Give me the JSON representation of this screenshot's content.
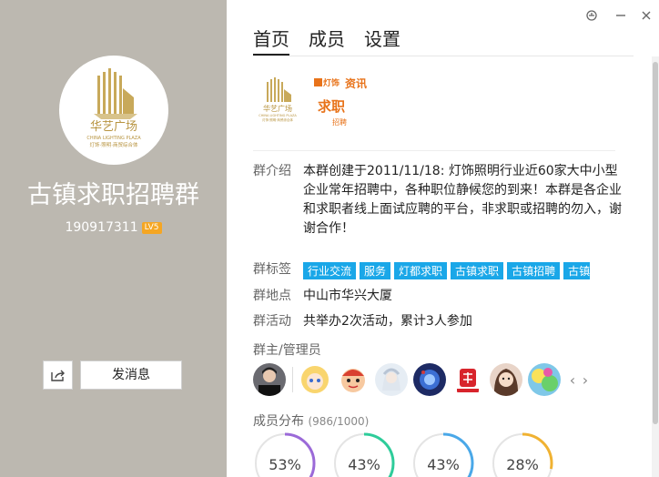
{
  "left": {
    "group_name": "古镇求职招聘群",
    "group_id": "190917311",
    "level": "LV5",
    "send_message_label": "发消息",
    "logo_cn": "华艺广场",
    "logo_en": "CHINA LIGHTING PLAZA",
    "logo_sub": "灯饰·照明·商贸综合体"
  },
  "tabs": [
    {
      "label": "首页",
      "active": true
    },
    {
      "label": "成员",
      "active": false
    },
    {
      "label": "设置",
      "active": false
    }
  ],
  "thumb": {
    "cn": "华艺广场",
    "en": "CHINA LIGHTING PLAZA",
    "sub": "灯饰·照明·商贸综合体",
    "lamp": "灯饰",
    "info": "资讯",
    "job": "求职",
    "hire": "招聘"
  },
  "info": {
    "intro_label": "群介绍",
    "intro_text": "本群创建于2011/11/18: 灯饰照明行业近60家大中小型企业常年招聘中，各种职位静候您的到来！本群是各企业和求职者线上面试应聘的平台，非求职或招聘的勿入，谢谢合作！",
    "tags_label": "群标签",
    "tags": [
      "行业交流",
      "服务",
      "灯都求职",
      "古镇求职",
      "古镇招聘",
      "古镇"
    ],
    "location_label": "群地点",
    "location": "中山市华兴大厦",
    "activity_label": "群活动",
    "activity": "共举办2次活动，累计3人参加",
    "admin_label": "群主/管理员",
    "dist_label": "成员分布",
    "dist_count": "(986/1000)"
  },
  "distribution": [
    {
      "percent": "53%",
      "value": 0.53,
      "color": "#9b6ad8"
    },
    {
      "percent": "43%",
      "value": 0.43,
      "color": "#2ecc9a"
    },
    {
      "percent": "43%",
      "value": 0.43,
      "color": "#4aa8e8"
    },
    {
      "percent": "28%",
      "value": 0.28,
      "color": "#f0b232"
    }
  ],
  "icons": {
    "skin": "skin-icon",
    "minimize": "minimize-icon",
    "close": "close-icon",
    "share": "share-icon"
  }
}
